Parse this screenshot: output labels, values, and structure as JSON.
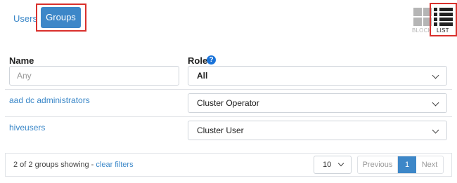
{
  "tabs": {
    "users": "Users",
    "groups": "Groups"
  },
  "views": {
    "block_label": "BLOCK",
    "list_label": "LIST"
  },
  "columns": {
    "name": "Name",
    "role": "Role"
  },
  "filters": {
    "name_placeholder": "Any",
    "role_selected": "All"
  },
  "rows": [
    {
      "name": "aad dc administrators",
      "role": "Cluster Operator"
    },
    {
      "name": "hiveusers",
      "role": "Cluster User"
    }
  ],
  "footer": {
    "status": "2 of 2 groups showing - ",
    "clear_filters": "clear filters",
    "page_size": "10",
    "previous": "Previous",
    "current_page": "1",
    "next": "Next"
  },
  "icons": {
    "help": "?"
  },
  "colors": {
    "accent": "#3d87c8",
    "highlight_outline": "#d9302c",
    "link": "#3a87c8"
  }
}
